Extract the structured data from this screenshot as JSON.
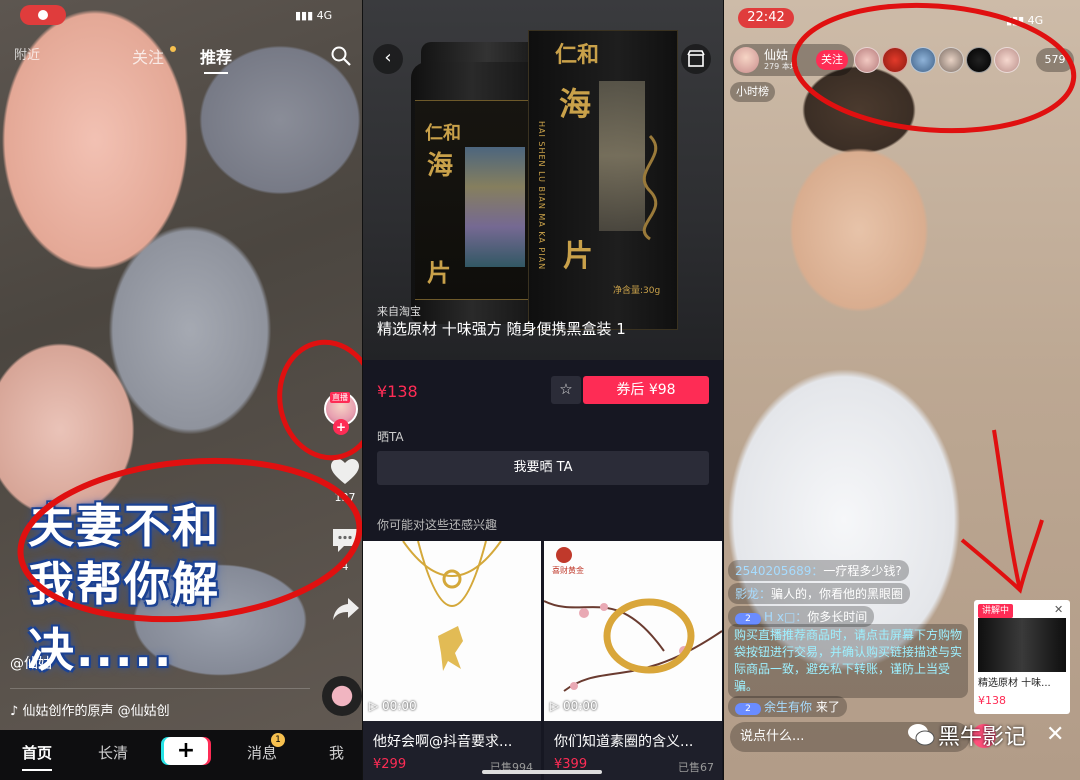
{
  "panel1": {
    "status_net": "4G",
    "tabs": {
      "nearby": "附近",
      "following": "关注",
      "recommended": "推荐"
    },
    "like_count": "137",
    "comment_count": "4",
    "caption_line1": "夫妻不和",
    "caption_line2": "我帮你解决.....",
    "author": "@仙姑",
    "music": "仙姑创作的原声    @仙姑创",
    "nav": {
      "home": "首页",
      "long": "长清",
      "plus": "+",
      "messages": "消息",
      "messages_badge": "1",
      "me": "我"
    },
    "avatar_label": "直播",
    "annotation_color": "#e01010"
  },
  "panel2": {
    "brand": "仁和",
    "product_mark": "海",
    "product_mark2": "片",
    "latin": "HAI SHEN LU BIAN MA KA PIAN",
    "net_weight": "净含量:30g",
    "source": "来自淘宝",
    "title": "精选原材 十味强方 随身便携黑盒装 1",
    "price": "¥138",
    "coupon": "券后 ¥98",
    "show_header": "晒TA",
    "show_button": "我要晒 TA",
    "interest_header": "你可能对这些还感兴趣",
    "cards": [
      {
        "duration": "00:00",
        "title": "他好会啊@抖音要求...",
        "price": "¥299",
        "sold": "已售994"
      },
      {
        "duration": "00:00",
        "title": "你们知道素圈的含义...",
        "price": "¥399",
        "sold": "已售67",
        "brand": "喜财黄金"
      }
    ]
  },
  "panel3": {
    "time": "22:42",
    "status_net": "4G",
    "host_name": "仙姑",
    "host_sub": "279 本场",
    "follow": "关注",
    "viewer_count": "579",
    "rank": "小时榜",
    "chat": [
      {
        "name": "2540205689：",
        "text": "一疗程多少钱?"
      },
      {
        "name": "影龙：",
        "text": "骗人的，你看他的黑眼圈"
      },
      {
        "level": "2",
        "name": "H x□：",
        "text": "你多长时间"
      }
    ],
    "notice": "购买直播推荐商品时，请点击屏幕下方购物袋按钮进行交易，并确认购买链接描述与实际商品一致，避免私下转账，谨防上当受骗。",
    "join": {
      "level": "2",
      "text": "余生有你",
      "suffix": "来了"
    },
    "product": {
      "tag": "讲解中",
      "close": "✕",
      "title": "精选原材 十味...",
      "price": "¥138"
    },
    "say_placeholder": "说点什么...",
    "close": "✕",
    "watermark": "黑牛影记"
  }
}
